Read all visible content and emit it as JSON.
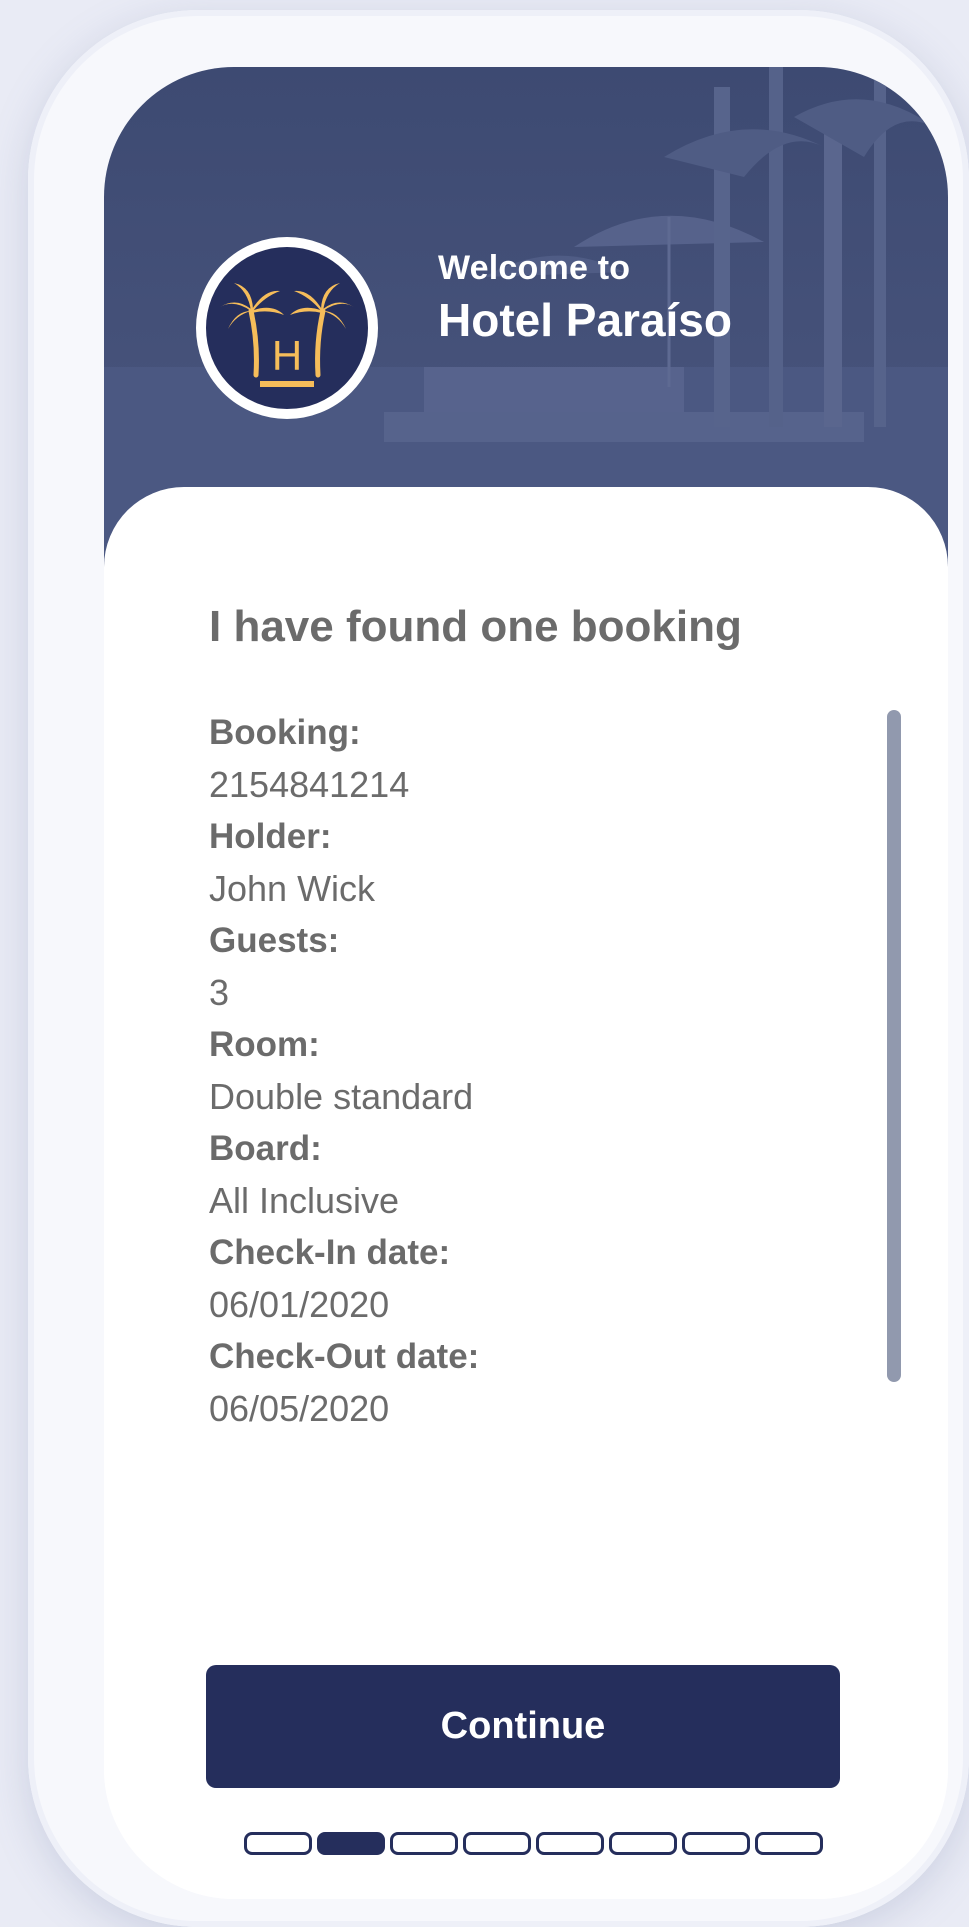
{
  "header": {
    "welcome_line": "Welcome to",
    "hotel_name": "Hotel Paraíso",
    "logo_icon": "palm-trees-h-logo-icon",
    "logo_letter": "H"
  },
  "booking": {
    "title": "I have found one booking",
    "fields": [
      {
        "label": "Booking:",
        "value": "2154841214"
      },
      {
        "label": "Holder:",
        "value": "John Wick"
      },
      {
        "label": "Guests:",
        "value": "3"
      },
      {
        "label": "Room:",
        "value": "Double standard"
      },
      {
        "label": "Board:",
        "value": "All Inclusive"
      },
      {
        "label": "Check-In date:",
        "value": "06/01/2020"
      },
      {
        "label": "Check-Out date:",
        "value": "06/05/2020"
      }
    ]
  },
  "actions": {
    "continue_label": "Continue"
  },
  "progress": {
    "total_steps": 8,
    "current_step": 2
  },
  "colors": {
    "primary": "#252e5c",
    "header_bg": "#3d4a72",
    "logo_accent": "#f6bd5a",
    "text": "#6b6b6b",
    "scrollbar": "#9199ae"
  }
}
